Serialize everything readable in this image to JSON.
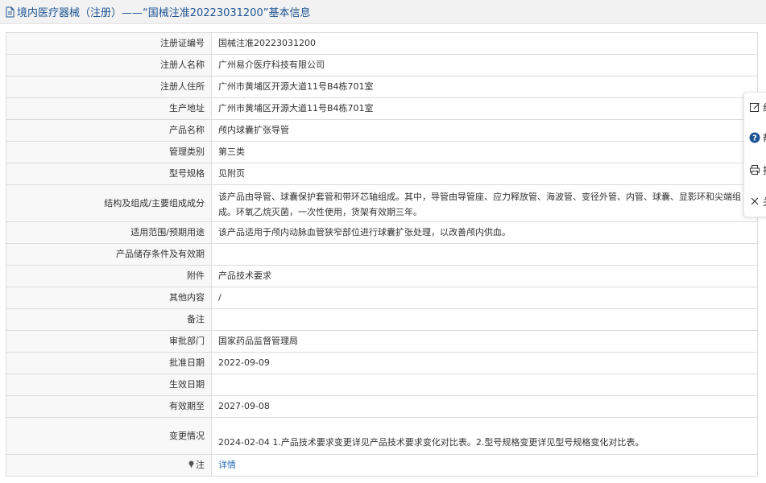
{
  "header": {
    "title": "境内医疗器械（注册）——“国械注准20223031200”基本信息"
  },
  "rows": [
    {
      "label": "注册证编号",
      "value": "国械注准20223031200"
    },
    {
      "label": "注册人名称",
      "value": "广州易介医疗科技有限公司"
    },
    {
      "label": "注册人住所",
      "value": "广州市黄埔区开源大道11号B4栋701室"
    },
    {
      "label": "生产地址",
      "value": "广州市黄埔区开源大道11号B4栋701室"
    },
    {
      "label": "产品名称",
      "value": "颅内球囊扩张导管"
    },
    {
      "label": "管理类别",
      "value": "第三类"
    },
    {
      "label": "型号规格",
      "value": "见附页"
    },
    {
      "label": "结构及组成/主要组成成分",
      "value": "该产品由导管、球囊保护套管和带环芯轴组成。其中，导管由导管座、应力释放管、海波管、变径外管、内管、球囊、显影环和尖端组成。环氧乙烷灭菌，一次性使用，货架有效期三年。"
    },
    {
      "label": "适用范围/预期用途",
      "value": "该产品适用于颅内动脉血管狭窄部位进行球囊扩张处理，以改善颅内供血。"
    },
    {
      "label": "产品储存条件及有效期",
      "value": ""
    },
    {
      "label": "附件",
      "value": "产品技术要求"
    },
    {
      "label": "其他内容",
      "value": "/"
    },
    {
      "label": "备注",
      "value": ""
    },
    {
      "label": "审批部门",
      "value": "国家药品监督管理局"
    },
    {
      "label": "批准日期",
      "value": "2022-09-09"
    },
    {
      "label": "生效日期",
      "value": ""
    },
    {
      "label": "有效期至",
      "value": "2027-09-08"
    },
    {
      "label": "变更情况",
      "value": "2024-02-04 1.产品技术要求变更详见产品技术要求变化对比表。2.型号规格变更详见型号规格变化对比表。"
    },
    {
      "label": "注",
      "value": "详情"
    }
  ],
  "float_toolbar": {
    "items": [
      {
        "label": "纠",
        "icon": "edit-icon"
      },
      {
        "label": "帮",
        "icon": "help-icon"
      },
      {
        "label": "打",
        "icon": "print-icon"
      },
      {
        "label": "关",
        "icon": "close-icon"
      }
    ]
  },
  "colors": {
    "title_text": "#1e5494",
    "link": "#2a6bb5",
    "label_bg": "#f8f8f8",
    "border": "#dcdcdc",
    "help_circle": "#1e5494"
  }
}
